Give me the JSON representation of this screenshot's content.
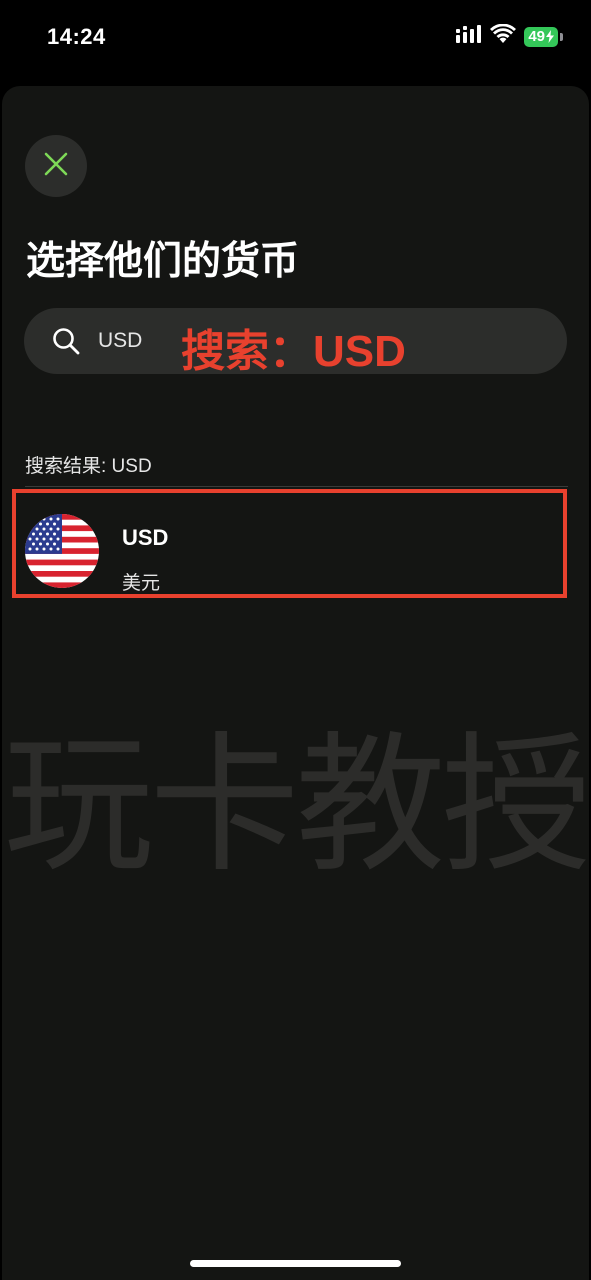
{
  "status_bar": {
    "time": "14:24",
    "battery": "49",
    "icons": [
      "cellular-signal-icon",
      "wifi-icon",
      "battery-charging-icon"
    ]
  },
  "sheet": {
    "close_icon": "close-icon",
    "title": "选择他们的货币",
    "search": {
      "value": "USD",
      "placeholder": "",
      "annotation": "搜索：USD"
    },
    "results_label": "搜索结果: USD",
    "results": [
      {
        "flag": "us-flag-icon",
        "code": "USD",
        "name": "美元"
      }
    ],
    "watermark": "玩卡教授"
  },
  "colors": {
    "background": "#141513",
    "surface": "#2c2d2b",
    "accent_close": "#7ed957",
    "annotation_red": "#e8412e",
    "battery_green": "#34c759"
  }
}
